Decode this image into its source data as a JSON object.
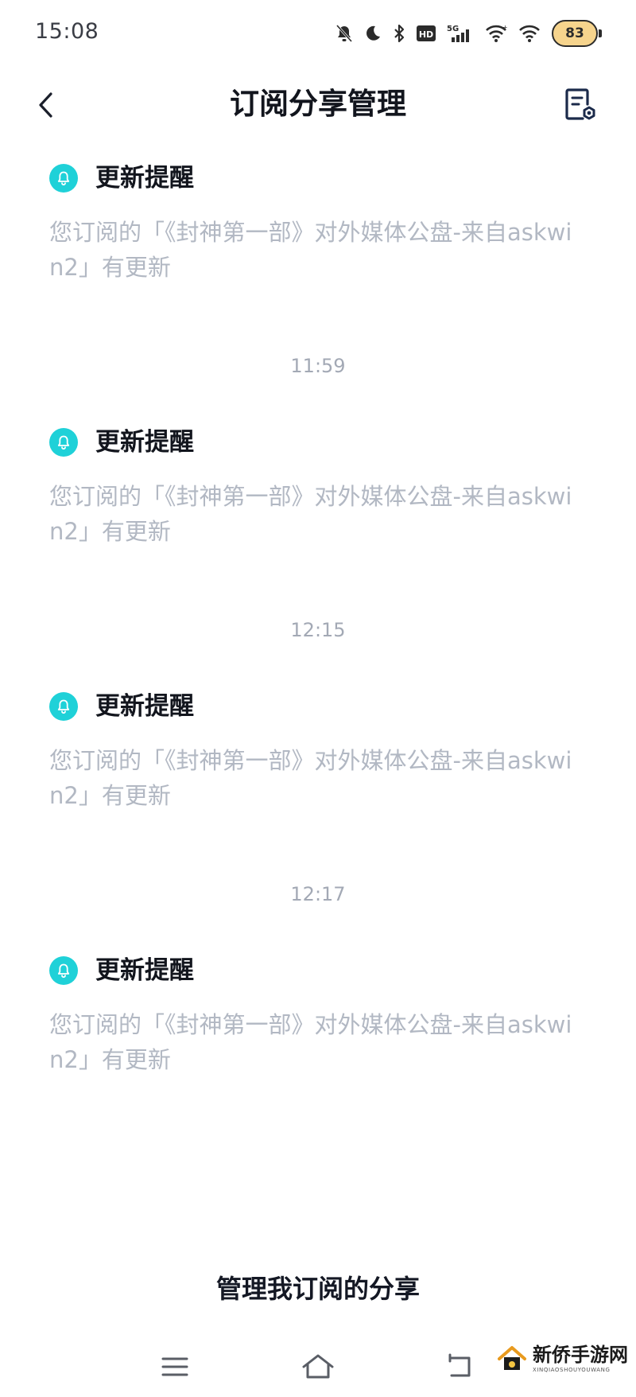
{
  "status_bar": {
    "time": "15:08",
    "network_label": "5G",
    "hd_label": "HD",
    "battery": "83"
  },
  "header": {
    "title": "订阅分享管理"
  },
  "feed": [
    {
      "title": "更新提醒",
      "body": "您订阅的「《封神第一部》对外媒体公盘-来自askwin2」有更新"
    },
    {
      "time": "11:59",
      "title": "更新提醒",
      "body": "您订阅的「《封神第一部》对外媒体公盘-来自askwin2」有更新"
    },
    {
      "time": "12:15",
      "title": "更新提醒",
      "body": "您订阅的「《封神第一部》对外媒体公盘-来自askwin2」有更新"
    },
    {
      "time": "12:17",
      "title": "更新提醒",
      "body": "您订阅的「《封神第一部》对外媒体公盘-来自askwin2」有更新"
    }
  ],
  "footer": {
    "manage_link": "管理我订阅的分享"
  },
  "watermark": {
    "main": "新侨手游网",
    "sub": "XINQIAOSHOUYOUWANG"
  },
  "colors": {
    "accent_bell": "#1fd1d8",
    "body_text": "#b2b8c3",
    "title_text": "#12151d"
  }
}
